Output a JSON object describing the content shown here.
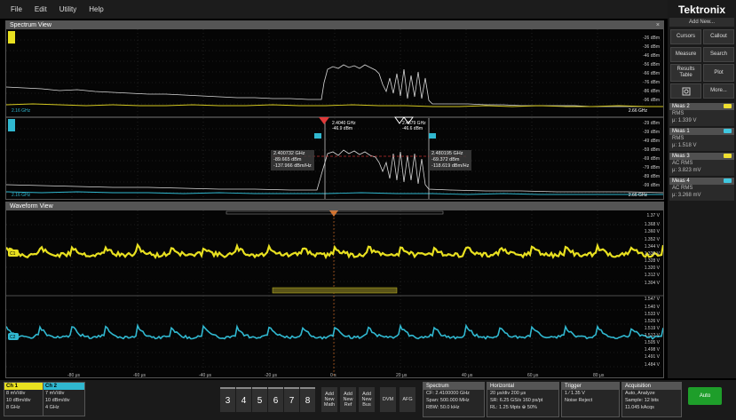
{
  "menu": [
    "File",
    "Edit",
    "Utility",
    "Help"
  ],
  "brand": "Tektronix",
  "right_panel": {
    "add_new": "Add New...",
    "buttons": [
      "Cursors",
      "Callout",
      "Measure",
      "Search",
      "Results Table",
      "Plot",
      "More..."
    ],
    "measurements": [
      {
        "title": "Meas 2",
        "kind": "RMS",
        "value": "μ: 1.339 V",
        "color": "#f0e030"
      },
      {
        "title": "Meas 1",
        "kind": "RMS",
        "value": "μ: 1.518 V",
        "color": "#40c8e0"
      },
      {
        "title": "Meas 3",
        "kind": "AC RMS",
        "value": "μ: 3.823 mV",
        "color": "#f0e030"
      },
      {
        "title": "Meas 4",
        "kind": "AC RMS",
        "value": "μ: 3.268 mV",
        "color": "#40c8e0"
      }
    ]
  },
  "spectrum": {
    "title": "Spectrum View",
    "close": "×",
    "dbm_top": [
      "-26 dBm",
      "-36 dBm",
      "-46 dBm",
      "-56 dBm",
      "-66 dBm",
      "-76 dBm",
      "-86 dBm",
      "-96 dBm"
    ],
    "dbm_bottom": [
      "-29 dBm",
      "-39 dBm",
      "-49 dBm",
      "-59 dBm",
      "-69 dBm",
      "-79 dBm",
      "-89 dBm",
      "-99 dBm"
    ],
    "freq_start_top": "2.16 GHz",
    "freq_end_top": "2.66 GHz",
    "freq_start_bottom": "2.16 GHz",
    "freq_end_bottom": "2.66 GHz",
    "marker1": [
      "2.4040 GHz",
      "-46.9 dBm"
    ],
    "marker2": [
      "2.4679 GHz",
      "-46.6 dBm"
    ],
    "readout_left": [
      "2.400732 GHz",
      "-89.665 dBm",
      "-137.966 dBm/Hz"
    ],
    "readout_right": [
      "2.480195 GHz",
      "-69.372 dBm",
      "-118.619 dBm/Hz"
    ],
    "ch1_color": "#e8e020",
    "ch2_color": "#30b8d0"
  },
  "waveform": {
    "title": "Waveform View",
    "volt_top": [
      "1.37 V",
      "1.368 V",
      "1.360 V",
      "1.352 V",
      "1.344 V",
      "1.336 V",
      "1.328 V",
      "1.320 V",
      "1.312 V",
      "1.304 V"
    ],
    "volt_bottom": [
      "1.547 V",
      "1.540 V",
      "1.533 V",
      "1.526 V",
      "1.519 V",
      "1.512 V",
      "1.505 V",
      "1.498 V",
      "1.491 V",
      "1.484 V"
    ],
    "time_labels": [
      "-80 μs",
      "-60 μs",
      "-40 μs",
      "-20 μs",
      "0 s",
      "20 μs",
      "40 μs",
      "60 μs",
      "80 μs"
    ],
    "ch1_label": "C1",
    "ch2_label": "C2"
  },
  "bottom": {
    "ch1": {
      "title": "Ch 1",
      "lines": [
        "8 mV/div",
        "10 dBm/div",
        "8 GHz"
      ]
    },
    "ch2": {
      "title": "Ch 2",
      "lines": [
        "7 mV/div",
        "10 dBm/div",
        "4 GHz"
      ]
    },
    "num_buttons": [
      "3",
      "4",
      "5",
      "6",
      "7",
      "8"
    ],
    "add_buttons": [
      "Add New Math",
      "Add New Ref",
      "Add New Bus"
    ],
    "dvm": "DVM",
    "afg": "AFG",
    "spectrum": {
      "title": "Spectrum",
      "lines": [
        "CF: 2.4100000 GHz",
        "Span: 500.000 MHz",
        "RBW: 50.0 kHz"
      ]
    },
    "horizontal": {
      "title": "Horizontal",
      "lines": [
        "20 μs/div    200 μs",
        "SR: 6.25 GS/s   160 ps/pt",
        "RL: 1.25 Mpts   ⊕ 50%"
      ]
    },
    "trigger": {
      "title": "Trigger",
      "lines": [
        "1  ⁄  1.35 V",
        "Noise Reject"
      ]
    },
    "acquisition": {
      "title": "Acquisition",
      "lines": [
        "Auto,       Analyze",
        "Sample: 12 bits",
        "11.045 kAcqs"
      ]
    },
    "auto": "Auto"
  }
}
